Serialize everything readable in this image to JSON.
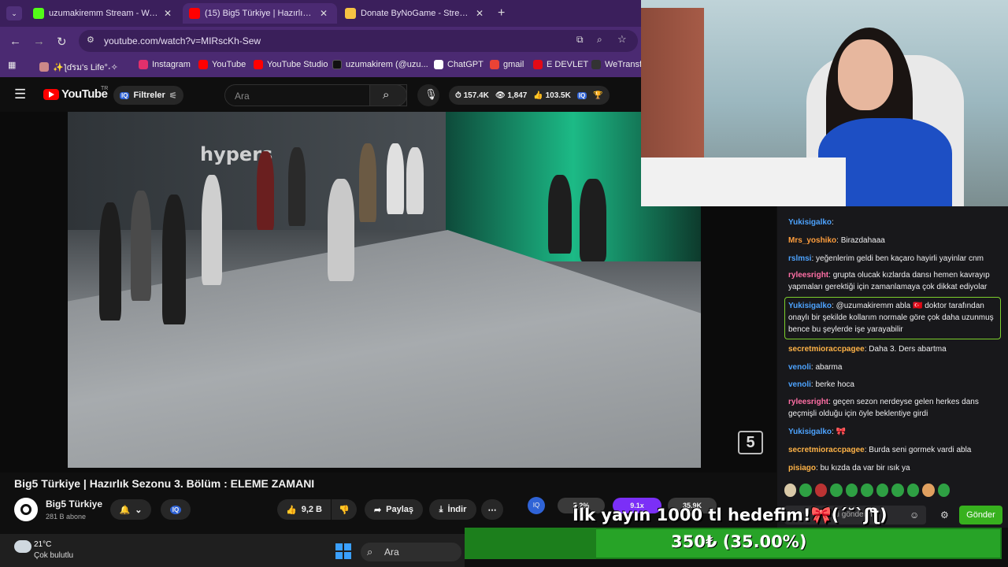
{
  "browser": {
    "tabs": [
      {
        "title": "uzumakiremm Stream - Watch L",
        "color": "#53fc18"
      },
      {
        "title": "(15) Big5 Türkiye | Hazırlık S",
        "color": "#ff0000"
      },
      {
        "title": "Donate ByNoGame - Streamer",
        "color": "#f6c343"
      }
    ],
    "url": "youtube.com/watch?v=MIRscKh-Sew",
    "bookmarks": [
      {
        "label": "✨ƪɗรม's Life°˖✧",
        "color": "#c88"
      },
      {
        "label": "Instagram",
        "color": "#e1306c"
      },
      {
        "label": "YouTube",
        "color": "#ff0000"
      },
      {
        "label": "YouTube Studio",
        "color": "#ff0000"
      },
      {
        "label": "uzumakirem (@uzu...",
        "color": "#111111"
      },
      {
        "label": "ChatGPT",
        "color": "#ffffff"
      },
      {
        "label": "gmail",
        "color": "#ea4335"
      },
      {
        "label": "E DEVLET",
        "color": "#e30a17"
      },
      {
        "label": "WeTransfer",
        "color": "#333333"
      }
    ]
  },
  "youtube": {
    "logo_text": "YouTube",
    "region": "TR",
    "filter_label": "Filtreler",
    "search_placeholder": "Ara",
    "stats": {
      "views": "157.4K",
      "watching": "1,847",
      "likes": "103.5K"
    },
    "video": {
      "overlay_text": "hypers",
      "channel_logo": "5"
    },
    "title": "Big5 Türkiye | Hazırlık Sezonu 3. Bölüm : ELEME ZAMANI",
    "channel": {
      "name": "Big5 Türkiye",
      "subs": "281 B abone"
    },
    "actions": {
      "like_count": "9,2 B",
      "share": "Paylaş",
      "download": "İndir"
    },
    "progress_chips": [
      {
        "label": "5.2%",
        "color": "#3a3a3a"
      },
      {
        "label": "9.1x",
        "color": "#7b2ff7"
      },
      {
        "label": "35.9K",
        "color": "#3a3a3a"
      }
    ]
  },
  "chat": {
    "messages": [
      {
        "user": "Yukisigalko",
        "color": "#4da3ff",
        "text": ""
      },
      {
        "user": "Mrs_yoshiko",
        "color": "#ff9e3d",
        "text": "Birazdahaaa"
      },
      {
        "user": "rslmsi",
        "color": "#4da3ff",
        "text": "yeğenlerim geldi ben kaçaro hayirli yayinlar cnm"
      },
      {
        "user": "ryleesright",
        "color": "#ff6fa5",
        "text": "grupta olucak kızlarda dansı hemen kavrayıp yapmaları gerektiği için zamanlamaya çok dikkat ediyolar"
      },
      {
        "user": "Yukisigalko",
        "color": "#4da3ff",
        "text": "@uzumakiremm abla 🇹🇷 doktor tarafından onaylı bir şekilde kollarım normale göre çok daha uzunmuş bence bu şeylerde işe yarayabilir"
      },
      {
        "user": "secretmioraccpagee",
        "color": "#ffb347",
        "text": "Daha 3. Ders abartma"
      },
      {
        "user": "venoli",
        "color": "#4da3ff",
        "text": "abarma"
      },
      {
        "user": "venoli",
        "color": "#4da3ff",
        "text": "berke hoca"
      },
      {
        "user": "ryleesright",
        "color": "#ff6fa5",
        "text": "geçen sezon nerdeyse gelen herkes dans geçmişli olduğu için öyle beklentiye girdi"
      },
      {
        "user": "Yukisigalko",
        "color": "#4da3ff",
        "text": "🎀"
      },
      {
        "user": "secretmioraccpagee",
        "color": "#ffb347",
        "text": "Burda seni gormek vardi abla"
      },
      {
        "user": "pisiago",
        "color": "#ffb347",
        "text": "bu kızda da var bir ısık ya"
      }
    ],
    "input_placeholder": "Bir ileti gönderin",
    "send_label": "Gönder"
  },
  "goal": {
    "text": "İlk yayın 1000 tl hedefim!🎀(´˘`ʃƪ)",
    "amount": "350₺ (35.00%)",
    "progress": 0.35
  },
  "taskbar": {
    "temp": "21°C",
    "weather": "Çok bulutlu",
    "search": "Ara"
  }
}
